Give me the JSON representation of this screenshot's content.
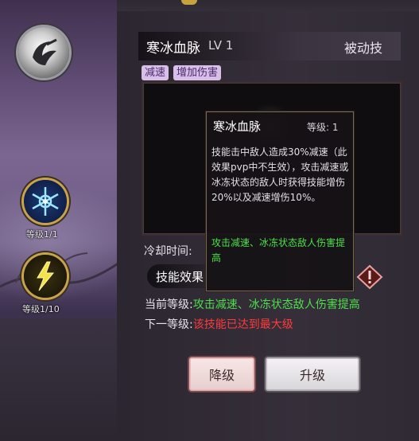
{
  "header": {
    "skill_name": "寒冰血脉",
    "level": "LV 1",
    "skill_type": "被动技"
  },
  "tags": [
    "减速",
    "增加伤害"
  ],
  "skills_sidebar": [
    {
      "icon": "snowflake-icon",
      "level_label": "等级1/1"
    },
    {
      "icon": "lightning-icon",
      "level_label": "等级1/10"
    }
  ],
  "cooldown_label": "冷却时间:",
  "effect_header": "技能效果",
  "current_level": {
    "label": "当前等级:",
    "value": "攻击减速、冰冻状态敌人伤害提高"
  },
  "next_level": {
    "label": "下一等级:",
    "value": "该技能已达到最大级"
  },
  "buttons": {
    "downgrade": "降级",
    "upgrade": "升级"
  },
  "tooltip": {
    "title": "寒冰血脉",
    "level": "等级: 1",
    "description": "技能击中敌人造成30%减速（此效果pvp中不生效），攻击减速或冰冻状态的敌人时获得技能增伤20%以及减速增伤10%。",
    "effect": "攻击减速、冰冻状态敌人伤害提高"
  },
  "colors": {
    "effect_green": "#4ddf4b",
    "max_red": "#ff3b3b",
    "tag_bg": "#d8bfe9",
    "gold_border": "#c9a34c"
  }
}
